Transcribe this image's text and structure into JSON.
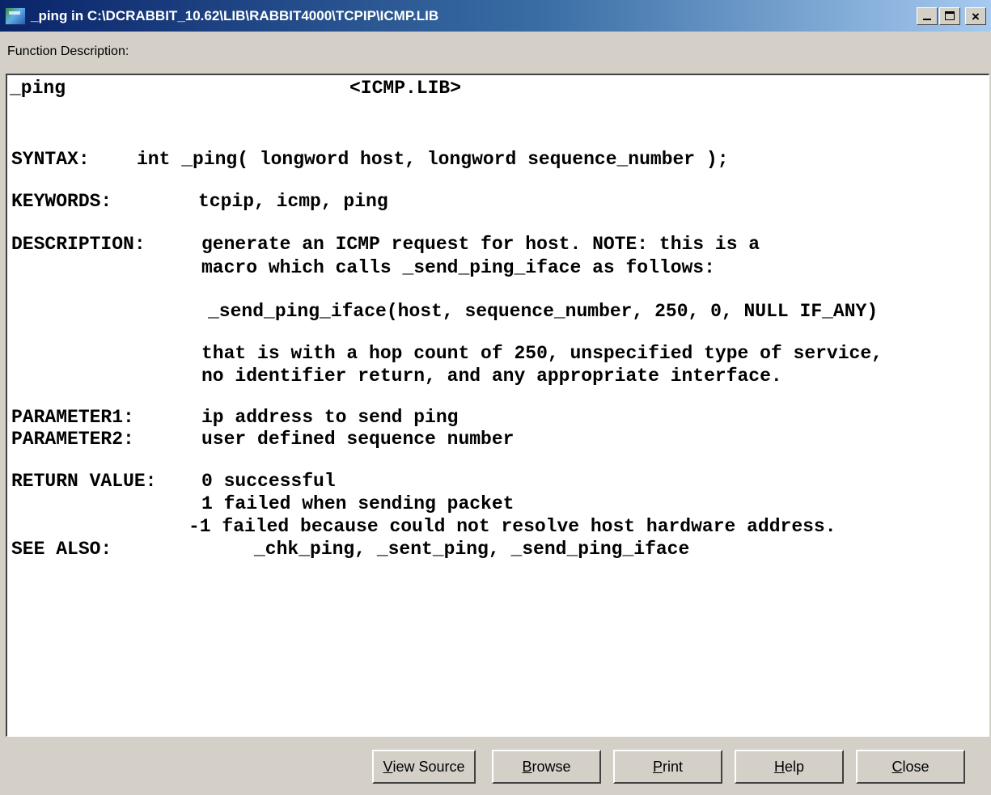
{
  "window": {
    "title": "_ping in C:\\DCRABBIT_10.62\\LIB\\RABBIT4000\\TCPIP\\ICMP.LIB",
    "minimize_label": "minimize",
    "maximize_label": "maximize",
    "close_glyph": "×"
  },
  "section_label": "Function Description:",
  "doc": {
    "function_name": "_ping",
    "library": "<ICMP.LIB>",
    "syntax_label": "SYNTAX:",
    "syntax_value": "int _ping( longword host, longword sequence_number );",
    "keywords_label": "KEYWORDS:",
    "keywords_value": "tcpip, icmp, ping",
    "description_label": "DESCRIPTION:",
    "description_lines": [
      "generate an ICMP request for host. NOTE: this is a",
      "macro which calls _send_ping_iface as follows:",
      "_send_ping_iface(host, sequence_number, 250, 0, NULL IF_ANY)",
      "that is with a hop count of 250, unspecified type of service,",
      "no identifier return, and any appropriate interface."
    ],
    "parameter1_label": "PARAMETER1:",
    "parameter1_value": "ip address to send ping",
    "parameter2_label": "PARAMETER2:",
    "parameter2_value": "user defined sequence number",
    "return_label": "RETURN VALUE:",
    "return_lines": [
      "0 successful",
      "1 failed when sending packet",
      "-1 failed because could not resolve host hardware address."
    ],
    "see_also_label": "SEE ALSO:",
    "see_also_value": "_chk_ping, _sent_ping, _send_ping_iface"
  },
  "buttons": {
    "view_source": {
      "mnemonic": "V",
      "rest": "iew Source"
    },
    "browse": {
      "mnemonic": "B",
      "rest": "rowse"
    },
    "print": {
      "mnemonic": "P",
      "rest": "rint"
    },
    "help": {
      "mnemonic": "H",
      "rest": "elp"
    },
    "close": {
      "mnemonic": "C",
      "rest": "lose"
    }
  },
  "colors": {
    "titlebar_start": "#0a246a",
    "titlebar_end": "#a6caf0",
    "face": "#d4d0c8"
  },
  "icons": [
    "app-icon",
    "minimize-icon",
    "maximize-icon",
    "close-icon"
  ]
}
